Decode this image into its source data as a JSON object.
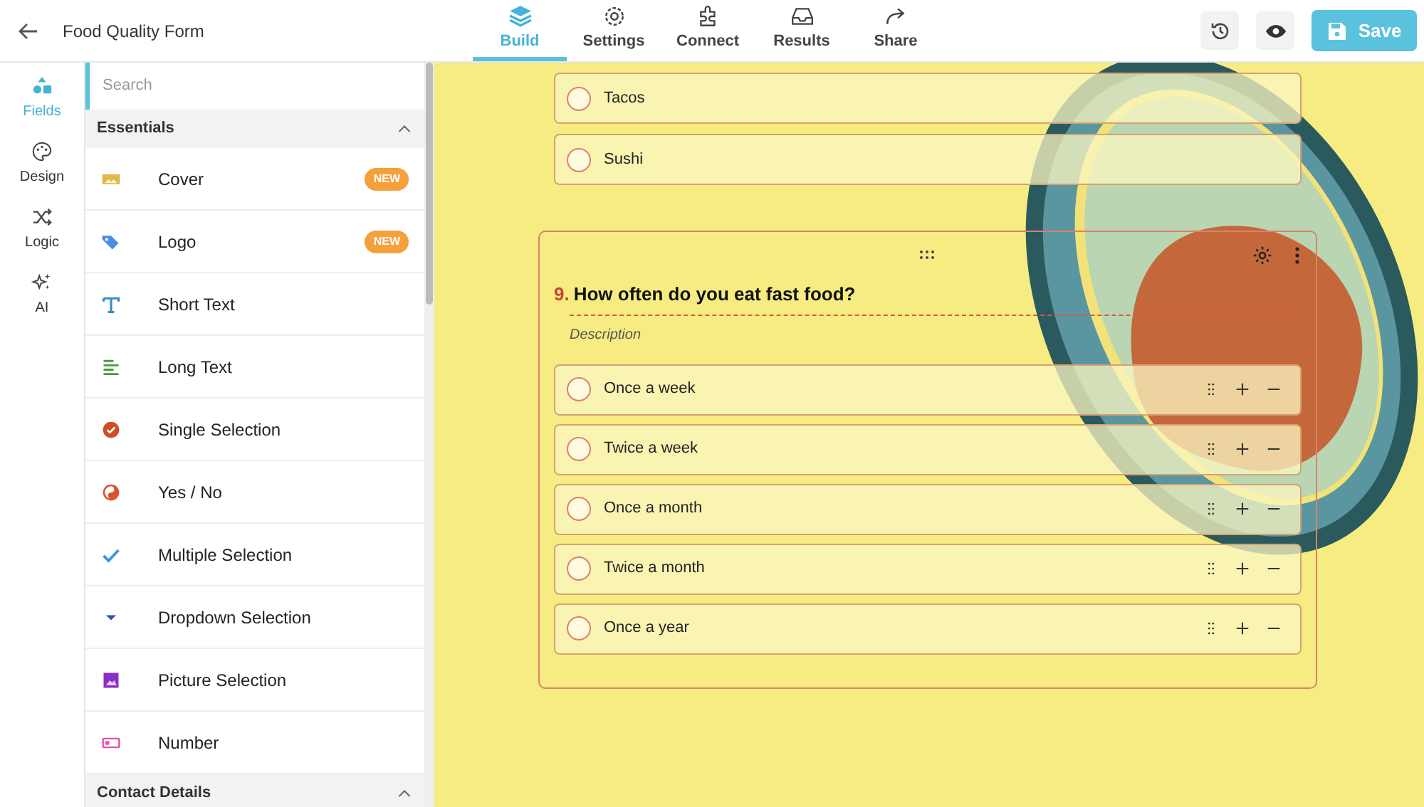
{
  "header": {
    "title": "Food Quality Form",
    "tabs": [
      {
        "label": "Build",
        "kind": "build",
        "selected": true
      },
      {
        "label": "Settings",
        "kind": "settings",
        "selected": false
      },
      {
        "label": "Connect",
        "kind": "connect",
        "selected": false
      },
      {
        "label": "Results",
        "kind": "results",
        "selected": false
      },
      {
        "label": "Share",
        "kind": "share",
        "selected": false
      }
    ],
    "save_label": "Save"
  },
  "rail": [
    {
      "label": "Fields",
      "kind": "fields",
      "selected": true
    },
    {
      "label": "Design",
      "kind": "design",
      "selected": false
    },
    {
      "label": "Logic",
      "kind": "logic",
      "selected": false
    },
    {
      "label": "AI",
      "kind": "ai",
      "selected": false
    }
  ],
  "panel": {
    "search": {
      "placeholder": "Search"
    },
    "sections": [
      {
        "title": "Essentials",
        "expanded": true,
        "items": [
          {
            "label": "Cover",
            "kind": "cover",
            "badge": "NEW"
          },
          {
            "label": "Logo",
            "kind": "logo",
            "badge": "NEW"
          },
          {
            "label": "Short Text",
            "kind": "short_text"
          },
          {
            "label": "Long Text",
            "kind": "long_text"
          },
          {
            "label": "Single Selection",
            "kind": "single"
          },
          {
            "label": "Yes / No",
            "kind": "yesno"
          },
          {
            "label": "Multiple Selection",
            "kind": "multiple"
          },
          {
            "label": "Dropdown Selection",
            "kind": "dropdown"
          },
          {
            "label": "Picture Selection",
            "kind": "picture"
          },
          {
            "label": "Number",
            "kind": "number"
          }
        ]
      },
      {
        "title": "Contact Details",
        "expanded": true
      }
    ]
  },
  "canvas": {
    "previous_options": [
      {
        "label": "Tacos",
        "selected": false
      },
      {
        "label": "Sushi",
        "selected": false
      }
    ],
    "question": {
      "number": "9.",
      "title": "How often do you eat fast food?",
      "description_placeholder": "Description",
      "options": [
        {
          "label": "Once a week",
          "selected": false
        },
        {
          "label": "Twice a week",
          "selected": false
        },
        {
          "label": "Once a month",
          "selected": false
        },
        {
          "label": "Twice a month",
          "selected": false
        },
        {
          "label": "Once a year",
          "selected": false
        }
      ]
    }
  }
}
